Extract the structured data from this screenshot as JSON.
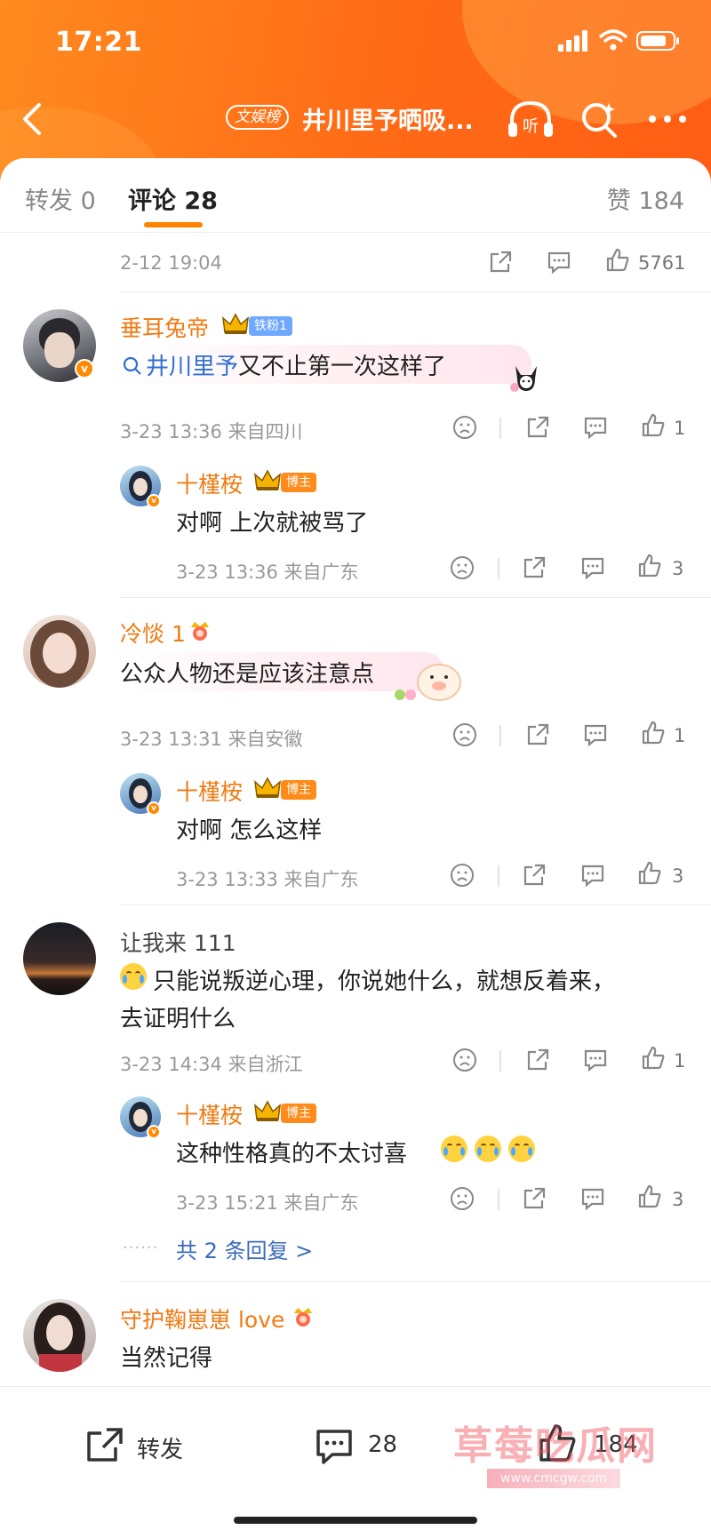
{
  "status_bar": {
    "time": "17:21"
  },
  "nav": {
    "tag": "文娱榜",
    "title": "井川里予晒吸...",
    "listen_label": "听"
  },
  "tabs": {
    "repost": "转发 0",
    "comments": "评论 28",
    "likes": "赞 184"
  },
  "top_row": {
    "time": "2-12 19:04",
    "like_count": "5761"
  },
  "comments": [
    {
      "user": "垂耳兔帝",
      "fan_badge": "铁粉1",
      "topic": "井川里予",
      "text": "又不止第一次这样了",
      "meta": "3-23 13:36 来自四川",
      "likes": "1",
      "reply": {
        "user": "十槿桉",
        "badge": "博主",
        "text": "对啊 上次就被骂了",
        "meta": "3-23 13:36 来自广东",
        "likes": "3"
      }
    },
    {
      "user": "冷惔 1",
      "text": "公众人物还是应该注意点",
      "meta": "3-23 13:31 来自安徽",
      "likes": "1",
      "reply": {
        "user": "十槿桉",
        "badge": "博主",
        "text": "对啊 怎么这样",
        "meta": "3-23 13:33 来自广东",
        "likes": "3"
      }
    },
    {
      "user": "让我来 111",
      "text_line1": "只能说叛逆心理，你说她什么，就想反着来，",
      "text_line2": "去证明什么",
      "meta": "3-23 14:34 来自浙江",
      "likes": "1",
      "reply": {
        "user": "十槿桉",
        "badge": "博主",
        "text": "这种性格真的不太讨喜",
        "meta": "3-23 15:21 来自广东",
        "likes": "3"
      },
      "more_replies": "共 2 条回复 >"
    },
    {
      "user": "守护鞠崽崽 love",
      "text": "当然记得"
    }
  ],
  "bottom_bar": {
    "repost": "转发",
    "comments": "28",
    "likes": "184"
  },
  "watermark": {
    "text": "草莓吃瓜网",
    "url": "www.cmcgw.com"
  },
  "colors": {
    "brand_orange": "#ff7a1a",
    "username": "#f07a12",
    "topic_blue": "#2f6fd6"
  }
}
